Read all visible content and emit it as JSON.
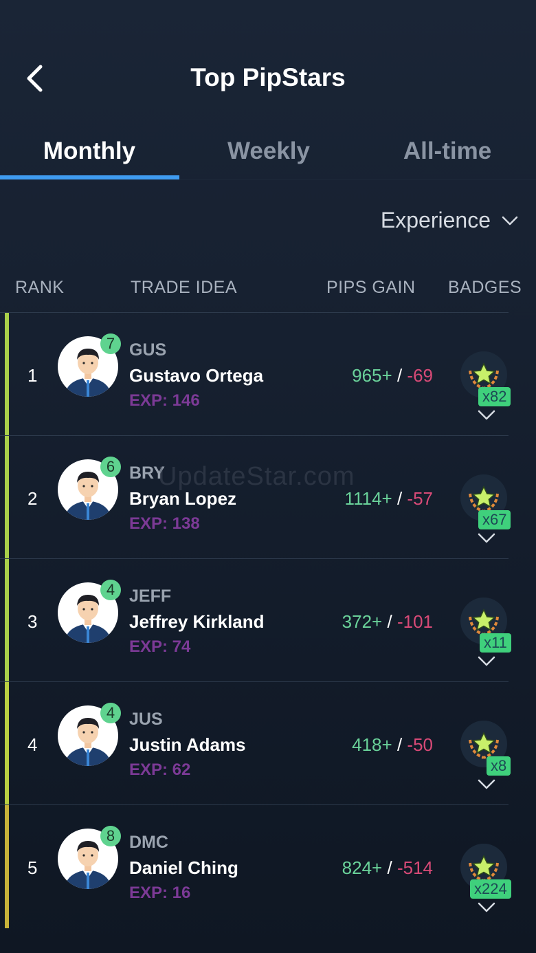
{
  "header": {
    "title": "Top PipStars",
    "back_icon": "chevron-left-icon"
  },
  "tabs": [
    {
      "label": "Monthly",
      "active": true
    },
    {
      "label": "Weekly",
      "active": false
    },
    {
      "label": "All-time",
      "active": false
    }
  ],
  "sort": {
    "selected": "Experience",
    "icon": "chevron-down-icon"
  },
  "columns": {
    "rank": "RANK",
    "trade_idea": "TRADE IDEA",
    "pips_gain": "PIPS GAIN",
    "badges": "BADGES"
  },
  "watermark": "UpdateStar.com",
  "colors": {
    "accent_tab": "#3f9bf0",
    "gain": "#6ad29a",
    "loss": "#d84a77",
    "exp": "#7c3a96",
    "level_badge": "#5fd38f",
    "row_accent_top": "#a9cf4a",
    "row_accent_bottom": "#c7b23a"
  },
  "rows": [
    {
      "rank": "1",
      "level": "7",
      "handle": "GUS",
      "name": "Gustavo Ortega",
      "exp": "EXP: 146",
      "gain": "965+",
      "sep": "/",
      "loss": "-69",
      "badges": "x82"
    },
    {
      "rank": "2",
      "level": "6",
      "handle": "BRY",
      "name": "Bryan Lopez",
      "exp": "EXP: 138",
      "gain": "1114+",
      "sep": "/",
      "loss": "-57",
      "badges": "x67"
    },
    {
      "rank": "3",
      "level": "4",
      "handle": "JEFF",
      "name": "Jeffrey Kirkland",
      "exp": "EXP: 74",
      "gain": "372+",
      "sep": "/",
      "loss": "-101",
      "badges": "x11"
    },
    {
      "rank": "4",
      "level": "4",
      "handle": "JUS",
      "name": "Justin Adams",
      "exp": "EXP: 62",
      "gain": "418+",
      "sep": "/",
      "loss": "-50",
      "badges": "x8"
    },
    {
      "rank": "5",
      "level": "8",
      "handle": "DMC",
      "name": "Daniel Ching",
      "exp": "EXP: 16",
      "gain": "824+",
      "sep": "/",
      "loss": "-514",
      "badges": "x224"
    }
  ]
}
